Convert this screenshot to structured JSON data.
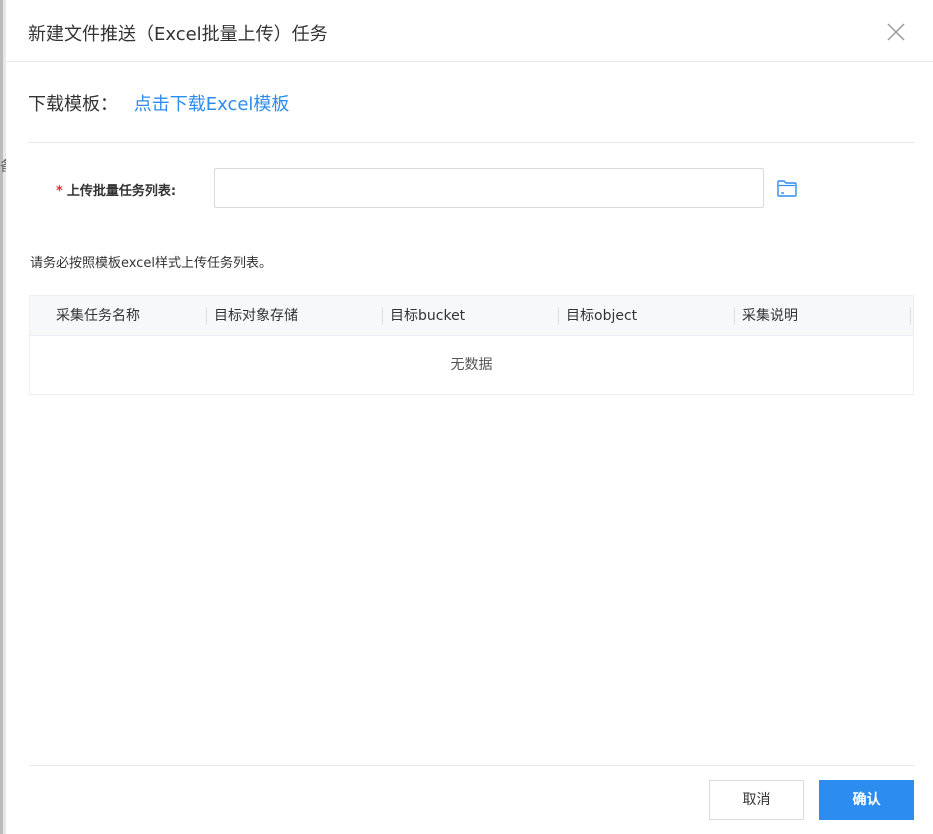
{
  "dialog": {
    "title": "新建文件推送（Excel批量上传）任务",
    "template_label": "下载模板：",
    "template_link": "点击下载Excel模板",
    "upload_label": "上传批量任务列表:",
    "required_mark": "*",
    "upload_value": "",
    "hint": "请务必按照模板excel样式上传任务列表。",
    "table": {
      "columns": [
        "采集任务名称",
        "目标对象存储",
        "目标bucket",
        "目标object",
        "采集说明"
      ],
      "rows": [],
      "empty_text": "无数据"
    },
    "buttons": {
      "cancel": "取消",
      "confirm": "确认"
    }
  },
  "backdrop": {
    "glyph": "备"
  },
  "colors": {
    "primary": "#2d8cf0",
    "required": "#e0302f"
  },
  "icons": [
    "close-icon",
    "folder-icon"
  ]
}
